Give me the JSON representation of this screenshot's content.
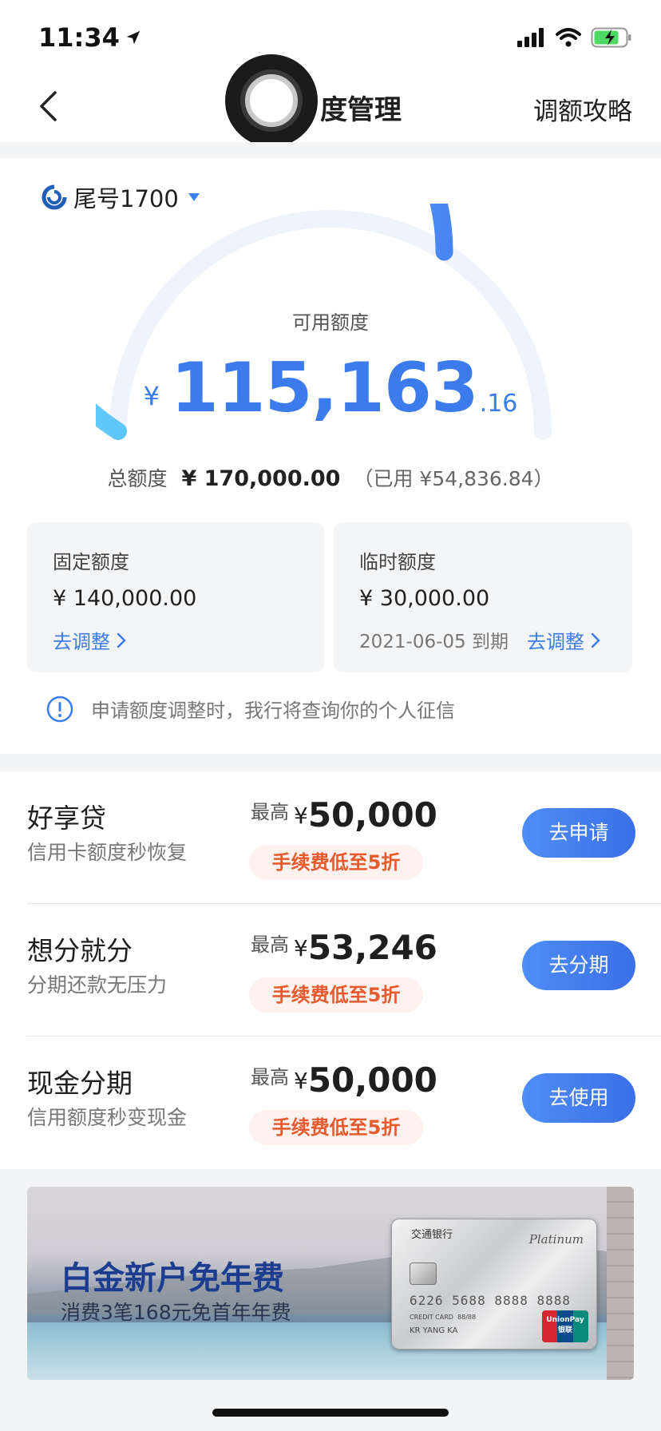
{
  "status": {
    "time": "11:34"
  },
  "nav": {
    "title": "额度管理",
    "title_visible": "度管理",
    "right": "调额攻略"
  },
  "card": {
    "label": "尾号1700"
  },
  "gauge": {
    "label": "可用额度",
    "currency": "¥",
    "amount_int": "115,163",
    "amount_dec": ".16",
    "fraction_available": 0.68
  },
  "total": {
    "label": "总额度",
    "amount": "¥ 170,000.00",
    "used": "（已用 ¥54,836.84）"
  },
  "fixed": {
    "title": "固定额度",
    "amount": "¥ 140,000.00",
    "link": "去调整"
  },
  "temp": {
    "title": "临时额度",
    "amount": "¥ 30,000.00",
    "expire": "2021-06-05 到期",
    "link": "去调整"
  },
  "notice": "申请额度调整时，我行将查询你的个人征信",
  "products": [
    {
      "name": "好享贷",
      "desc": "信用卡额度秒恢复",
      "max_label": "最高",
      "currency": "¥",
      "amount": "50,000",
      "fee": "手续费低至5折",
      "button": "去申请"
    },
    {
      "name": "想分就分",
      "desc": "分期还款无压力",
      "max_label": "最高",
      "currency": "¥",
      "amount": "53,246",
      "fee": "手续费低至5折",
      "button": "去分期"
    },
    {
      "name": "现金分期",
      "desc": "信用额度秒变现金",
      "max_label": "最高",
      "currency": "¥",
      "amount": "50,000",
      "fee": "手续费低至5折",
      "button": "去使用"
    }
  ],
  "banner": {
    "title": "白金新户免年费",
    "subtitle": "消费3笔168元免首年年费",
    "card_bank": "交通银行",
    "card_tier": "Platinum",
    "card_number": "6226 5688 8888 8888",
    "card_type": "CREDIT CARD",
    "card_valid": "88/88",
    "card_holder": "KR YANG KA",
    "network_en": "UnionPay",
    "network_cn": "银联"
  },
  "colors": {
    "accent": "#3b7bec",
    "fee_text": "#e65a2e",
    "fee_bg": "#fff2ee",
    "track": "#eef3fd"
  }
}
